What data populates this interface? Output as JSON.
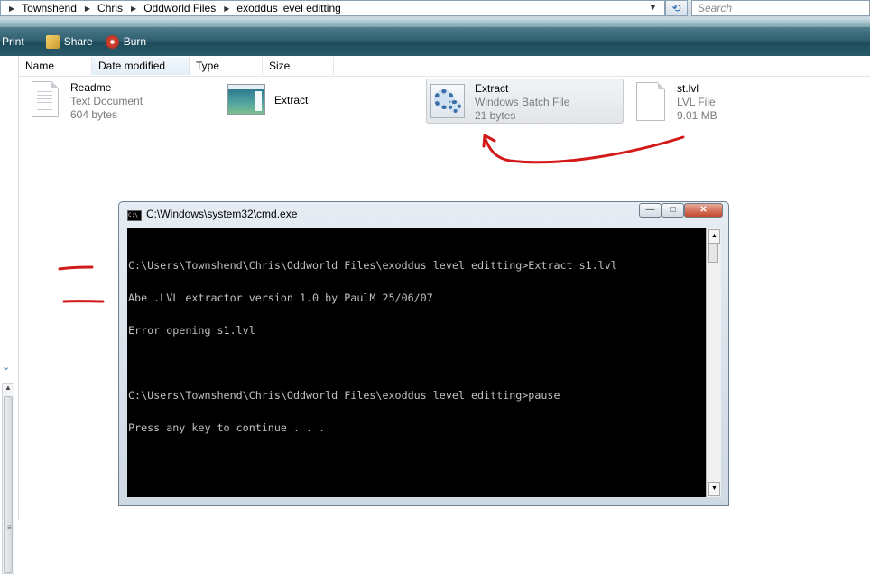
{
  "address_bar": {
    "crumbs": [
      "Townshend",
      "Chris",
      "Oddworld Files",
      "exoddus level editting"
    ],
    "search_placeholder": "Search"
  },
  "toolbar": {
    "print_label": "Print",
    "share_label": "Share",
    "burn_label": "Burn"
  },
  "columns": [
    "Name",
    "Date modified",
    "Type",
    "Size"
  ],
  "files": [
    {
      "name": "Readme",
      "type": "Text Document",
      "size": "604 bytes",
      "icon": "text-document-icon"
    },
    {
      "name": "Extract",
      "icon": "application-icon"
    },
    {
      "name": "Extract",
      "type": "Windows Batch File",
      "size": "21 bytes",
      "icon": "batch-file-icon"
    },
    {
      "name": "st.lvl",
      "type": "LVL File",
      "size": "9.01 MB",
      "icon": "generic-file-icon"
    }
  ],
  "cmd": {
    "title": "C:\\Windows\\system32\\cmd.exe",
    "lines": [
      "C:\\Users\\Townshend\\Chris\\Oddworld Files\\exoddus level editting>Extract s1.lvl",
      "Abe .LVL extractor version 1.0 by PaulM 25/06/07",
      "Error opening s1.lvl",
      "",
      "C:\\Users\\Townshend\\Chris\\Oddworld Files\\exoddus level editting>pause",
      "Press any key to continue . . ."
    ]
  },
  "colors": {
    "toolbar": "#2f5f70",
    "annotation": "#d31a1a",
    "console_bg": "#000000",
    "console_text": "#c0c0c0"
  }
}
